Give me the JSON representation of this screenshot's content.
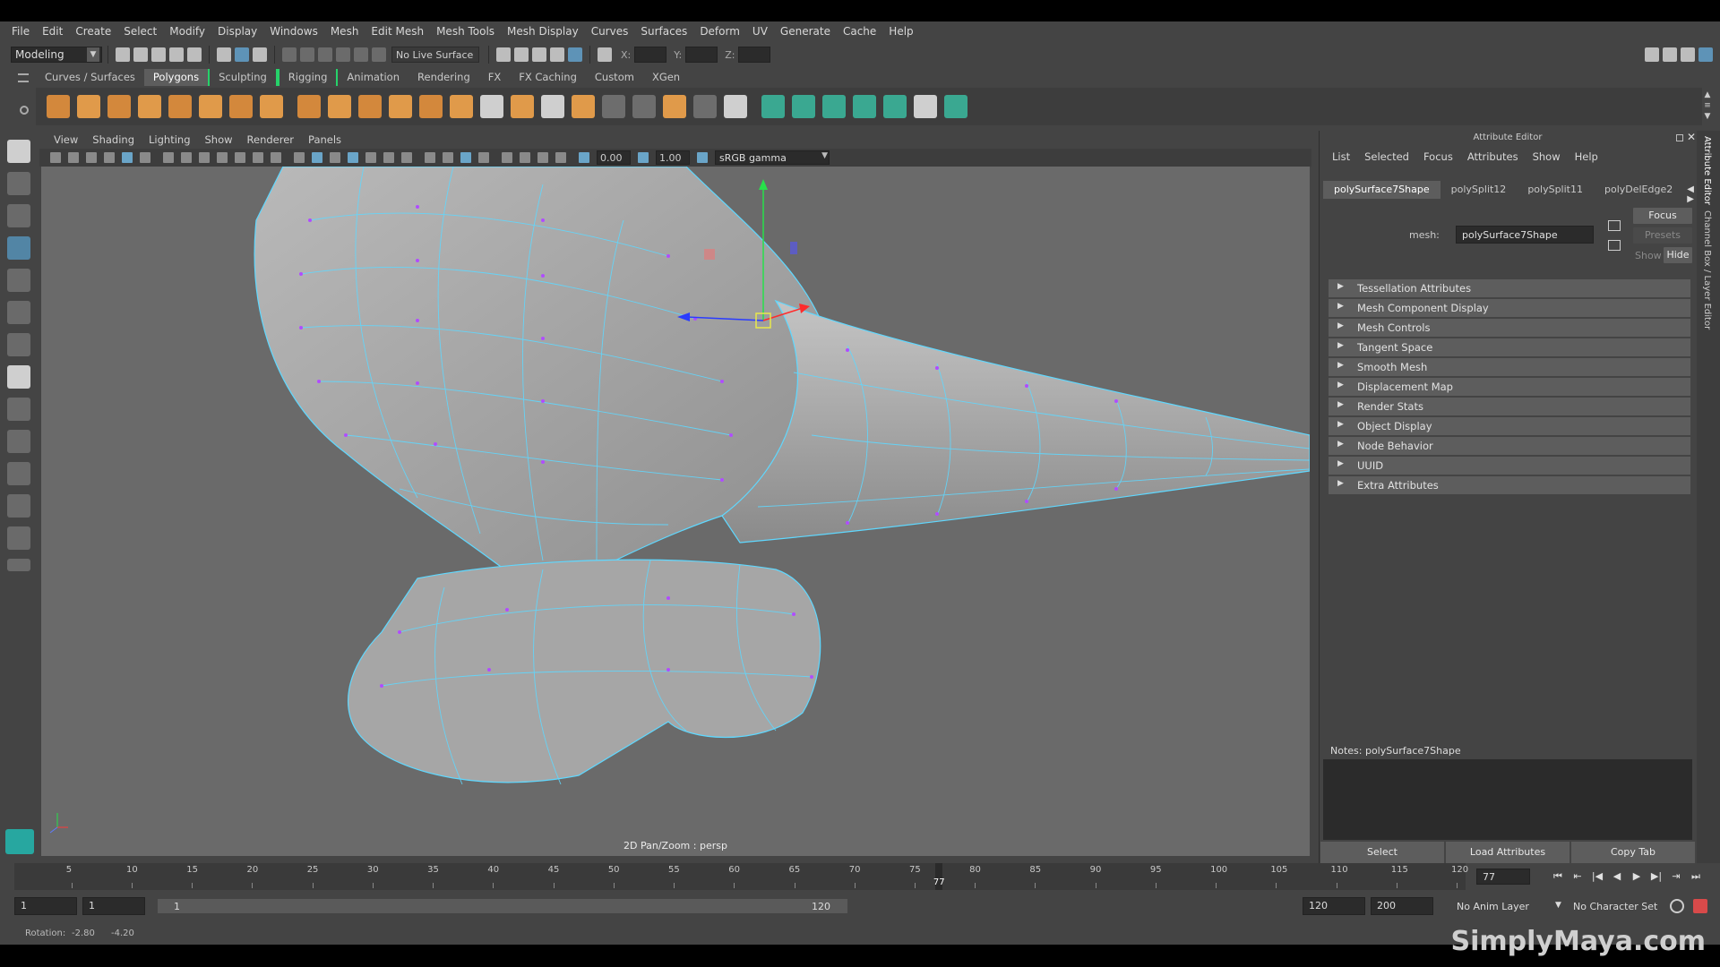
{
  "menubar": {
    "items": [
      "File",
      "Edit",
      "Create",
      "Select",
      "Modify",
      "Display",
      "Windows",
      "Mesh",
      "Edit Mesh",
      "Mesh Tools",
      "Mesh Display",
      "Curves",
      "Surfaces",
      "Deform",
      "UV",
      "Generate",
      "Cache",
      "Help"
    ]
  },
  "statusline": {
    "mode": "Modeling",
    "live_surface": "No Live Surface",
    "x_label": "X:",
    "y_label": "Y:",
    "z_label": "Z:"
  },
  "shelf": {
    "tabs": [
      "Curves / Surfaces",
      "Polygons",
      "Sculpting",
      "Rigging",
      "Animation",
      "Rendering",
      "FX",
      "FX Caching",
      "Custom",
      "XGen"
    ],
    "active_tab": "Polygons"
  },
  "panel": {
    "menu": [
      "View",
      "Shading",
      "Lighting",
      "Show",
      "Renderer",
      "Panels"
    ],
    "exposure": "0.00",
    "gamma_value": "1.00",
    "color_space": "sRGB gamma",
    "viewport_label": "2D Pan/Zoom : persp"
  },
  "attribute_editor": {
    "title": "Attribute Editor",
    "menu": [
      "List",
      "Selected",
      "Focus",
      "Attributes",
      "Show",
      "Help"
    ],
    "tabs": [
      "polySurface7Shape",
      "polySplit12",
      "polySplit11",
      "polyDelEdge2"
    ],
    "active_tab": "polySurface7Shape",
    "mesh_label": "mesh:",
    "mesh_value": "polySurface7Shape",
    "focus_button": "Focus",
    "presets_button": "Presets",
    "show_label": "Show",
    "hide_button": "Hide",
    "sections": [
      "Tessellation Attributes",
      "Mesh Component Display",
      "Mesh Controls",
      "Tangent Space",
      "Smooth Mesh",
      "Displacement Map",
      "Render Stats",
      "Object Display",
      "Node Behavior",
      "UUID",
      "Extra Attributes"
    ],
    "notes_label": "Notes:  polySurface7Shape",
    "bottom_buttons": [
      "Select",
      "Load Attributes",
      "Copy Tab"
    ]
  },
  "side_tabs": [
    "Attribute Editor",
    "Channel Box / Layer Editor"
  ],
  "timeline": {
    "ticks": [
      5,
      10,
      15,
      20,
      25,
      30,
      35,
      40,
      45,
      50,
      55,
      60,
      65,
      70,
      75,
      80,
      85,
      90,
      95,
      100,
      105,
      110,
      115,
      120
    ],
    "current_frame_marker": "77",
    "current_frame_field": "77",
    "playback_buttons": [
      "⏮",
      "⇤",
      "|◀",
      "◀",
      "▶",
      "▶|",
      "⇥",
      "⏭"
    ]
  },
  "range": {
    "start_field": "1",
    "playback_start": "1",
    "slider_start": "1",
    "slider_end": "120",
    "playback_end": "120",
    "end_field": "200",
    "anim_layer": "No Anim Layer",
    "character_set": "No Character Set"
  },
  "helpline": {
    "label": "Rotation:",
    "v1": "-2.80",
    "v2": "-4.20"
  },
  "watermark": "SimplyMaya.com"
}
